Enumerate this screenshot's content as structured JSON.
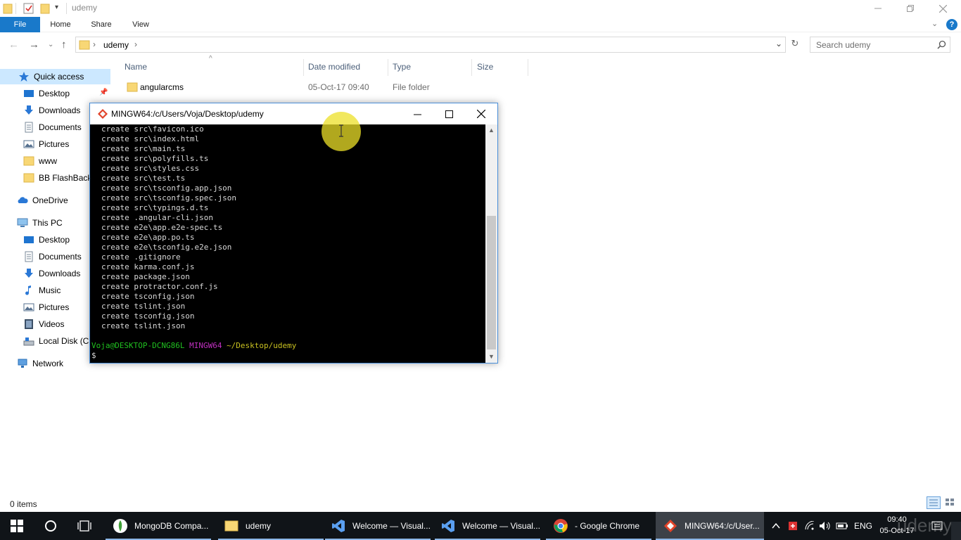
{
  "explorer": {
    "title": "udemy",
    "ribbon_tabs": [
      "File",
      "Home",
      "Share",
      "View"
    ],
    "breadcrumb": [
      "udemy"
    ],
    "search_placeholder": "Search udemy",
    "columns": [
      "Name",
      "Date modified",
      "Type",
      "Size"
    ],
    "files": [
      {
        "name": "angularcms",
        "date": "05-Oct-17 09:40",
        "type": "File folder",
        "size": ""
      }
    ],
    "status": "0 items"
  },
  "sidebar": {
    "quick_access": "Quick access",
    "quick_items": [
      "Desktop",
      "Downloads",
      "Documents",
      "Pictures",
      "www",
      "BB FlashBack Pro"
    ],
    "onedrive": "OneDrive",
    "this_pc": "This PC",
    "pc_items": [
      "Desktop",
      "Documents",
      "Downloads",
      "Music",
      "Pictures",
      "Videos",
      "Local Disk (C:)"
    ],
    "network": "Network"
  },
  "terminal": {
    "title": "MINGW64:/c/Users/Voja/Desktop/udemy",
    "lines": [
      "create src\\favicon.ico",
      "create src\\index.html",
      "create src\\main.ts",
      "create src\\polyfills.ts",
      "create src\\styles.css",
      "create src\\test.ts",
      "create src\\tsconfig.app.json",
      "create src\\tsconfig.spec.json",
      "create src\\typings.d.ts",
      "create .angular-cli.json",
      "create e2e\\app.e2e-spec.ts",
      "create e2e\\app.po.ts",
      "create e2e\\tsconfig.e2e.json",
      "create .gitignore",
      "create karma.conf.js",
      "create package.json",
      "create protractor.conf.js",
      "create tsconfig.json",
      "create tslint.json",
      "create tsconfig.json",
      "create tslint.json"
    ],
    "prompt_user": "Voja@DESKTOP-DCNG86L",
    "prompt_env": "MINGW64",
    "prompt_path": "~/Desktop/udemy",
    "prompt_symbol": "$"
  },
  "taskbar": {
    "apps": [
      "MongoDB Compa...",
      "udemy",
      "Welcome — Visual...",
      "Welcome — Visual...",
      "- Google Chrome",
      "MINGW64:/c/User..."
    ],
    "language": "ENG",
    "time": "09:40",
    "date": "05-Oct-17",
    "watermark": "udemy"
  },
  "colors": {
    "accent": "#1979ca",
    "taskbar": "#101418",
    "prompt_green": "#20c020",
    "prompt_magenta": "#c030c0",
    "prompt_yellow": "#c8c020"
  }
}
